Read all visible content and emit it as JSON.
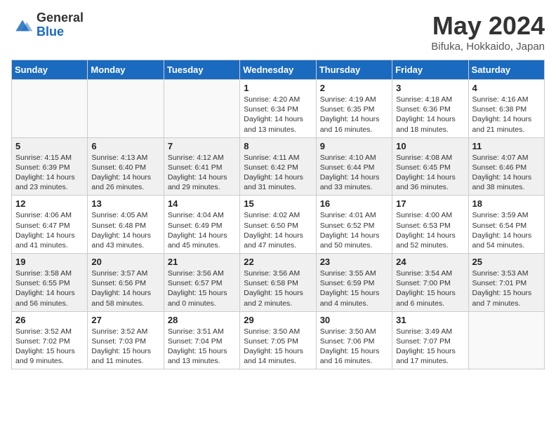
{
  "header": {
    "logo_general": "General",
    "logo_blue": "Blue",
    "month_title": "May 2024",
    "location": "Bifuka, Hokkaido, Japan"
  },
  "days_of_week": [
    "Sunday",
    "Monday",
    "Tuesday",
    "Wednesday",
    "Thursday",
    "Friday",
    "Saturday"
  ],
  "weeks": [
    [
      {
        "day": "",
        "content": ""
      },
      {
        "day": "",
        "content": ""
      },
      {
        "day": "",
        "content": ""
      },
      {
        "day": "1",
        "content": "Sunrise: 4:20 AM\nSunset: 6:34 PM\nDaylight: 14 hours\nand 13 minutes."
      },
      {
        "day": "2",
        "content": "Sunrise: 4:19 AM\nSunset: 6:35 PM\nDaylight: 14 hours\nand 16 minutes."
      },
      {
        "day": "3",
        "content": "Sunrise: 4:18 AM\nSunset: 6:36 PM\nDaylight: 14 hours\nand 18 minutes."
      },
      {
        "day": "4",
        "content": "Sunrise: 4:16 AM\nSunset: 6:38 PM\nDaylight: 14 hours\nand 21 minutes."
      }
    ],
    [
      {
        "day": "5",
        "content": "Sunrise: 4:15 AM\nSunset: 6:39 PM\nDaylight: 14 hours\nand 23 minutes."
      },
      {
        "day": "6",
        "content": "Sunrise: 4:13 AM\nSunset: 6:40 PM\nDaylight: 14 hours\nand 26 minutes."
      },
      {
        "day": "7",
        "content": "Sunrise: 4:12 AM\nSunset: 6:41 PM\nDaylight: 14 hours\nand 29 minutes."
      },
      {
        "day": "8",
        "content": "Sunrise: 4:11 AM\nSunset: 6:42 PM\nDaylight: 14 hours\nand 31 minutes."
      },
      {
        "day": "9",
        "content": "Sunrise: 4:10 AM\nSunset: 6:44 PM\nDaylight: 14 hours\nand 33 minutes."
      },
      {
        "day": "10",
        "content": "Sunrise: 4:08 AM\nSunset: 6:45 PM\nDaylight: 14 hours\nand 36 minutes."
      },
      {
        "day": "11",
        "content": "Sunrise: 4:07 AM\nSunset: 6:46 PM\nDaylight: 14 hours\nand 38 minutes."
      }
    ],
    [
      {
        "day": "12",
        "content": "Sunrise: 4:06 AM\nSunset: 6:47 PM\nDaylight: 14 hours\nand 41 minutes."
      },
      {
        "day": "13",
        "content": "Sunrise: 4:05 AM\nSunset: 6:48 PM\nDaylight: 14 hours\nand 43 minutes."
      },
      {
        "day": "14",
        "content": "Sunrise: 4:04 AM\nSunset: 6:49 PM\nDaylight: 14 hours\nand 45 minutes."
      },
      {
        "day": "15",
        "content": "Sunrise: 4:02 AM\nSunset: 6:50 PM\nDaylight: 14 hours\nand 47 minutes."
      },
      {
        "day": "16",
        "content": "Sunrise: 4:01 AM\nSunset: 6:52 PM\nDaylight: 14 hours\nand 50 minutes."
      },
      {
        "day": "17",
        "content": "Sunrise: 4:00 AM\nSunset: 6:53 PM\nDaylight: 14 hours\nand 52 minutes."
      },
      {
        "day": "18",
        "content": "Sunrise: 3:59 AM\nSunset: 6:54 PM\nDaylight: 14 hours\nand 54 minutes."
      }
    ],
    [
      {
        "day": "19",
        "content": "Sunrise: 3:58 AM\nSunset: 6:55 PM\nDaylight: 14 hours\nand 56 minutes."
      },
      {
        "day": "20",
        "content": "Sunrise: 3:57 AM\nSunset: 6:56 PM\nDaylight: 14 hours\nand 58 minutes."
      },
      {
        "day": "21",
        "content": "Sunrise: 3:56 AM\nSunset: 6:57 PM\nDaylight: 15 hours\nand 0 minutes."
      },
      {
        "day": "22",
        "content": "Sunrise: 3:56 AM\nSunset: 6:58 PM\nDaylight: 15 hours\nand 2 minutes."
      },
      {
        "day": "23",
        "content": "Sunrise: 3:55 AM\nSunset: 6:59 PM\nDaylight: 15 hours\nand 4 minutes."
      },
      {
        "day": "24",
        "content": "Sunrise: 3:54 AM\nSunset: 7:00 PM\nDaylight: 15 hours\nand 6 minutes."
      },
      {
        "day": "25",
        "content": "Sunrise: 3:53 AM\nSunset: 7:01 PM\nDaylight: 15 hours\nand 7 minutes."
      }
    ],
    [
      {
        "day": "26",
        "content": "Sunrise: 3:52 AM\nSunset: 7:02 PM\nDaylight: 15 hours\nand 9 minutes."
      },
      {
        "day": "27",
        "content": "Sunrise: 3:52 AM\nSunset: 7:03 PM\nDaylight: 15 hours\nand 11 minutes."
      },
      {
        "day": "28",
        "content": "Sunrise: 3:51 AM\nSunset: 7:04 PM\nDaylight: 15 hours\nand 13 minutes."
      },
      {
        "day": "29",
        "content": "Sunrise: 3:50 AM\nSunset: 7:05 PM\nDaylight: 15 hours\nand 14 minutes."
      },
      {
        "day": "30",
        "content": "Sunrise: 3:50 AM\nSunset: 7:06 PM\nDaylight: 15 hours\nand 16 minutes."
      },
      {
        "day": "31",
        "content": "Sunrise: 3:49 AM\nSunset: 7:07 PM\nDaylight: 15 hours\nand 17 minutes."
      },
      {
        "day": "",
        "content": ""
      }
    ]
  ]
}
